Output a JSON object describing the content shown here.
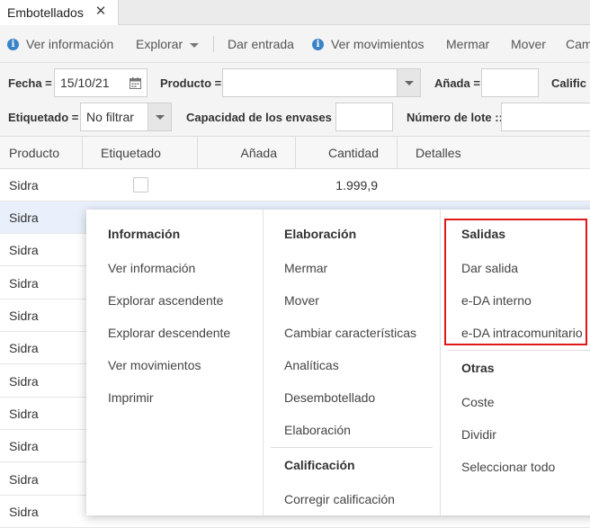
{
  "tab": {
    "label": "Embotellados",
    "close": "✕"
  },
  "toolbar": {
    "ver_informacion": "Ver información",
    "explorar": "Explorar",
    "dar_entrada": "Dar entrada",
    "ver_movimientos": "Ver movimientos",
    "mermar": "Mermar",
    "mover": "Mover",
    "cam": "Cam"
  },
  "filters": {
    "fecha_label": "Fecha =",
    "fecha_value": "15/10/21",
    "producto_label": "Producto =",
    "producto_value": "",
    "anada_label": "Añada =",
    "anada_value": "",
    "calific_label": "Calific",
    "etiquetado_label": "Etiquetado =",
    "etiquetado_value": "No filtrar",
    "capacidad_label": "Capacidad de los envases =",
    "capacidad_value": "",
    "lote_label": "Número de lote ::",
    "lote_value": ""
  },
  "grid": {
    "columns": [
      "Producto",
      "Etiquetado",
      "Añada",
      "Cantidad",
      "Detalles"
    ],
    "rows": [
      {
        "producto": "Sidra",
        "cantidad": "1.999,9"
      },
      {
        "producto": "Sidra",
        "cantidad": ""
      },
      {
        "producto": "Sidra",
        "cantidad": ""
      },
      {
        "producto": "Sidra",
        "cantidad": ""
      },
      {
        "producto": "Sidra",
        "cantidad": ""
      },
      {
        "producto": "Sidra",
        "cantidad": ""
      },
      {
        "producto": "Sidra",
        "cantidad": ""
      },
      {
        "producto": "Sidra",
        "cantidad": ""
      },
      {
        "producto": "Sidra",
        "cantidad": ""
      },
      {
        "producto": "Sidra",
        "cantidad": ""
      },
      {
        "producto": "Sidra",
        "cantidad": ""
      }
    ]
  },
  "menu": {
    "informacion": {
      "title": "Información",
      "items": [
        "Ver información",
        "Explorar ascendente",
        "Explorar descendente",
        "Ver movimientos",
        "Imprimir"
      ]
    },
    "elaboracion": {
      "title": "Elaboración",
      "items": [
        "Mermar",
        "Mover",
        "Cambiar características",
        "Analíticas",
        "Desembotellado",
        "Elaboración"
      ]
    },
    "calificacion": {
      "title": "Calificación",
      "items": [
        "Corregir calificación"
      ]
    },
    "salidas": {
      "title": "Salidas",
      "items": [
        "Dar salida",
        "e-DA interno",
        "e-DA intracomunitario"
      ]
    },
    "otras": {
      "title": "Otras",
      "items": [
        "Coste",
        "Dividir",
        "Seleccionar todo"
      ]
    }
  },
  "colors": {
    "info_icon": "#3b83c7",
    "highlight": "#e01818",
    "selected_row": "#e9f0fb"
  }
}
